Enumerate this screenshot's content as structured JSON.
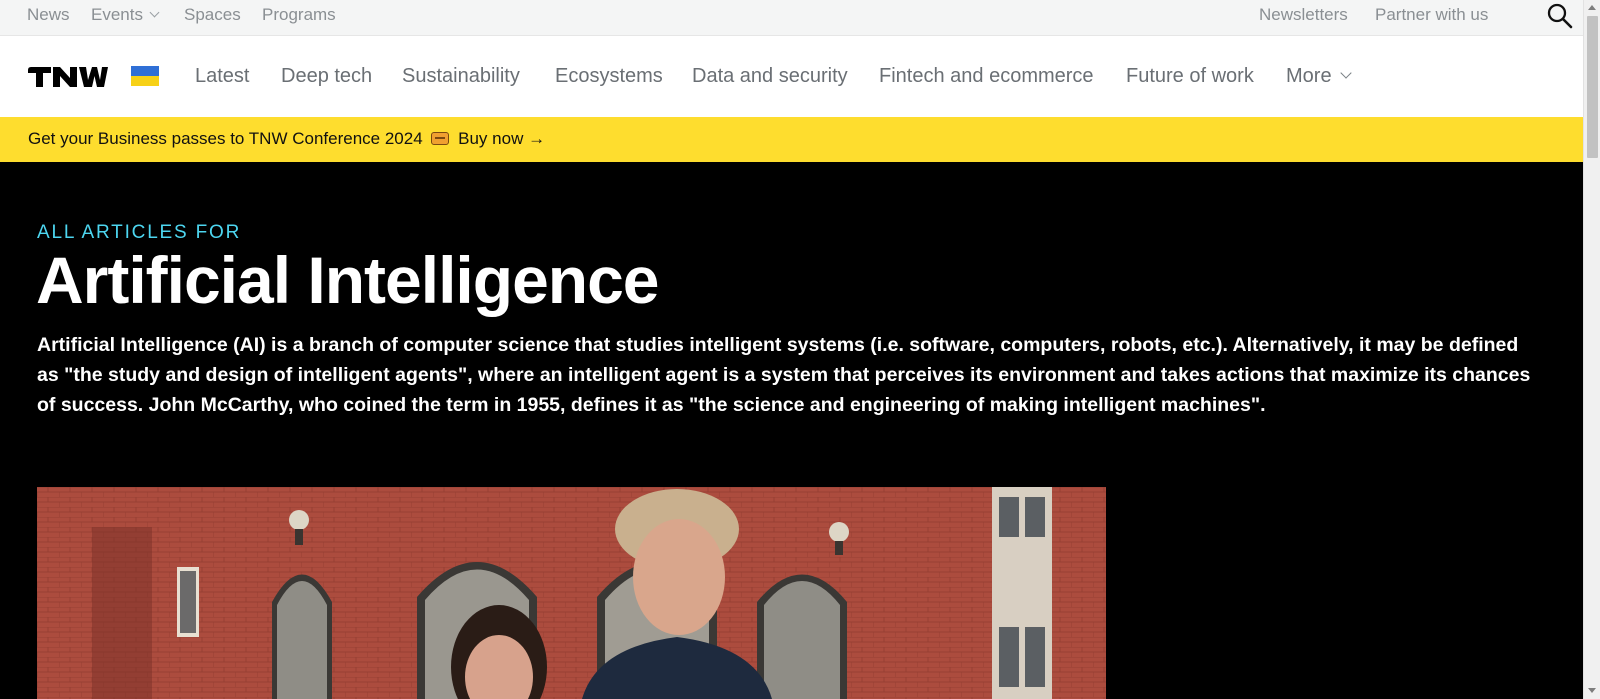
{
  "topbar": {
    "links": [
      "News",
      "Events",
      "Spaces",
      "Programs"
    ],
    "right_links": [
      "Newsletters",
      "Partner with us"
    ],
    "search_icon": "search-icon"
  },
  "nav": {
    "logo_text": "TNW",
    "flag": "ukraine-flag",
    "items": [
      "Latest",
      "Deep tech",
      "Sustainability",
      "Ecosystems",
      "Data and security",
      "Fintech and ecommerce",
      "Future of work",
      "More"
    ]
  },
  "banner": {
    "text": "Get your Business passes to TNW Conference 2024",
    "icon": "ticket-icon",
    "cta": "Buy now →",
    "color": "#fedd2e"
  },
  "hero": {
    "kicker": "ALL ARTICLES FOR",
    "title": "Artificial Intelligence",
    "description": "Artificial Intelligence (AI) is a branch of computer science that studies intelligent systems (i.e. software, computers, robots, etc.). Alternatively, it may be defined as \"the study and design of intelligent agents\", where an intelligent agent is a system that perceives its environment and takes actions that maximize its chances of success. John McCarthy, who coined the term in 1955, defines it as \"the science and engineering of making intelligent machines\".",
    "kicker_color": "#4dd6f0"
  },
  "featured_image": "two-people-in-brick-courtyard-photo"
}
